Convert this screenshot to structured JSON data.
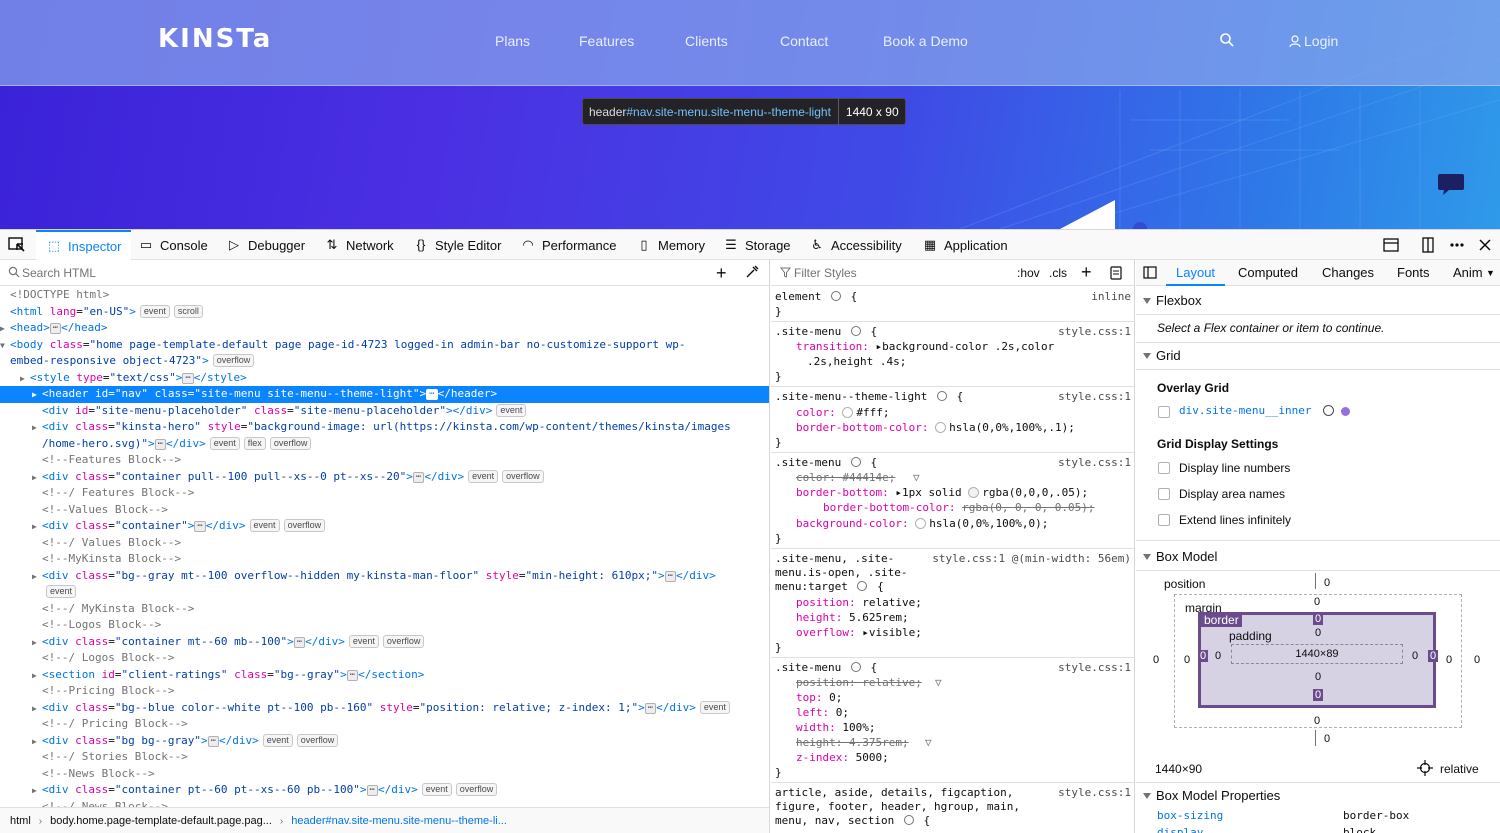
{
  "site": {
    "logo": "KINSTa",
    "nav": [
      "Plans",
      "Features",
      "Clients",
      "Contact",
      "Book a Demo"
    ],
    "login": "Login",
    "tooltip_tag": "header",
    "tooltip_selector": "#nav.site-menu.site-menu--theme-light",
    "tooltip_dims": "1440 x 90"
  },
  "toolbar": {
    "tabs": [
      "Inspector",
      "Console",
      "Debugger",
      "Network",
      "Style Editor",
      "Performance",
      "Memory",
      "Storage",
      "Accessibility",
      "Application"
    ],
    "selected_tab": "Inspector"
  },
  "inspector": {
    "search_placeholder": "Search HTML",
    "breadcrumb": [
      "html",
      "body.home.page-template-default.page.pag...",
      "header#nav.site-menu.site-menu--theme-li..."
    ]
  },
  "rules": {
    "filter_placeholder": "Filter Styles",
    "hov": ":hov",
    "cls": ".cls"
  },
  "layout": {
    "tabs": [
      "Layout",
      "Computed",
      "Changes",
      "Fonts",
      "Anim"
    ],
    "selected_tab": "Layout",
    "flexbox_title": "Flexbox",
    "flexbox_hint": "Select a Flex container or item to continue.",
    "grid_title": "Grid",
    "overlay_grid": "Overlay Grid",
    "grid_item": "div.site-menu__inner",
    "grid_settings": "Grid Display Settings",
    "options": [
      "Display line numbers",
      "Display area names",
      "Extend lines infinitely"
    ],
    "boxmodel_title": "Box Model",
    "bm_position": "position",
    "bm_margin": "margin",
    "bm_border": "border",
    "bm_padding": "padding",
    "bm_content": "1440×89",
    "bm_size": "1440×90",
    "bm_pos_type": "relative",
    "bm_props_title": "Box Model Properties",
    "bm_prop_name": "box-sizing",
    "bm_prop_value": "border-box",
    "bm_prop_name2": "display",
    "bm_prop_value2": "block"
  },
  "colors": {
    "accent": "#0a84ff",
    "site_gradient_start": "#3a22d8",
    "site_gradient_end": "#2f9ae9",
    "tag_color": "#0074e8",
    "attr_name": "#dd00a9",
    "attr_value": "#003eaa"
  }
}
